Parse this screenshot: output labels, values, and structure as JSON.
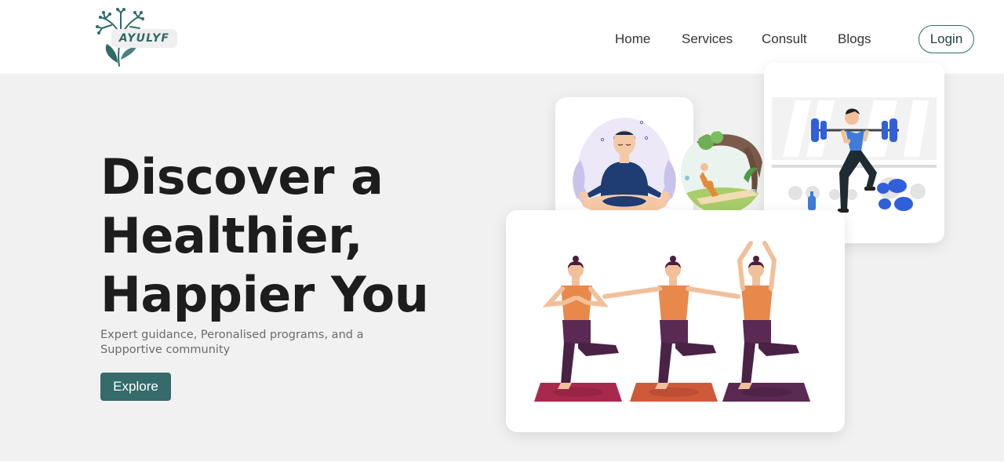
{
  "brand": {
    "logo_text": "AYULYF",
    "color": "#2f6a68"
  },
  "nav": {
    "home": "Home",
    "services": "Services",
    "consult": "Consult",
    "blogs": "Blogs",
    "login": "Login"
  },
  "hero": {
    "title_line1": "Discover a",
    "title_line2": "Healthier,",
    "title_line3": "Happier You",
    "subtitle": "Expert guidance, Peronalised programs, and a Supportive community",
    "cta": "Explore",
    "cta_color": "#356b6b",
    "background": "#f1f1f1"
  },
  "illustrations": [
    "meditation-illustration",
    "outdoor-yoga-illustration",
    "weightlifting-illustration",
    "tree-pose-yoga-illustration"
  ]
}
